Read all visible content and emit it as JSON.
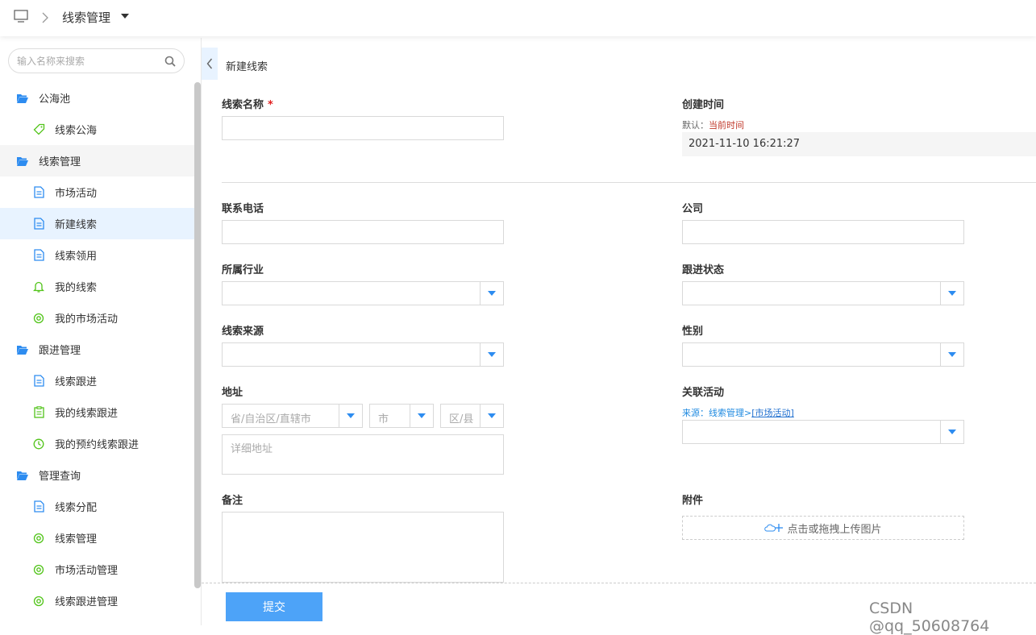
{
  "topbar": {
    "title": "线索管理"
  },
  "sidebar": {
    "search_placeholder": "输入名称来搜索",
    "items": [
      {
        "label": "公海池",
        "icon": "folder-open-icon"
      },
      {
        "label": "线索公海",
        "icon": "tag-icon"
      },
      {
        "label": "线索管理",
        "icon": "folder-open-icon"
      },
      {
        "label": "市场活动",
        "icon": "document-icon"
      },
      {
        "label": "新建线索",
        "icon": "document-icon"
      },
      {
        "label": "线索领用",
        "icon": "document-icon"
      },
      {
        "label": "我的线索",
        "icon": "bell-icon"
      },
      {
        "label": "我的市场活动",
        "icon": "target-icon"
      },
      {
        "label": "跟进管理",
        "icon": "folder-open-icon"
      },
      {
        "label": "线索跟进",
        "icon": "document-icon"
      },
      {
        "label": "我的线索跟进",
        "icon": "clipboard-icon"
      },
      {
        "label": "我的预约线索跟进",
        "icon": "clock-icon"
      },
      {
        "label": "管理查询",
        "icon": "folder-open-icon"
      },
      {
        "label": "线索分配",
        "icon": "document-icon"
      },
      {
        "label": "线索管理",
        "icon": "target-icon"
      },
      {
        "label": "市场活动管理",
        "icon": "target-icon"
      },
      {
        "label": "线索跟进管理",
        "icon": "target-icon"
      }
    ]
  },
  "form": {
    "page_title": "新建线索",
    "name_label": "线索名称",
    "required_mark": "*",
    "created_label": "创建时间",
    "created_hint_prefix": "默认：",
    "created_hint_value": "当前时间",
    "created_value": "2021-11-10 16:21:27",
    "phone_label": "联系电话",
    "company_label": "公司",
    "industry_label": "所属行业",
    "status_label": "跟进状态",
    "source_label": "线索来源",
    "gender_label": "性别",
    "address_label": "地址",
    "province_placeholder": "省/自治区/直辖市",
    "city_placeholder": "市",
    "district_placeholder": "区/县",
    "address_detail_placeholder": "详细地址",
    "activity_label": "关联活动",
    "activity_hint_prefix": "来源：线索管理>",
    "activity_hint_link": "[市场活动]",
    "remark_label": "备注",
    "attachment_label": "附件",
    "upload_text": "点击或拖拽上传图片",
    "submit_label": "提交"
  },
  "watermark": "CSDN @qq_50608764",
  "colors": {
    "accent": "#2d8cf0",
    "submit": "#4da3f8",
    "active_bg": "#e8f3ff"
  }
}
